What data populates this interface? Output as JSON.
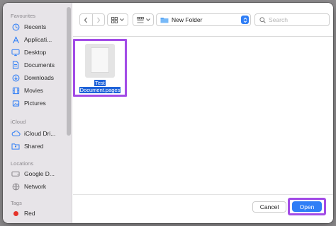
{
  "sidebar": {
    "favourites_header": "Favourites",
    "favourites": [
      {
        "label": "Recents",
        "icon": "clock-icon"
      },
      {
        "label": "Applicati...",
        "icon": "applications-icon"
      },
      {
        "label": "Desktop",
        "icon": "desktop-icon"
      },
      {
        "label": "Documents",
        "icon": "document-icon"
      },
      {
        "label": "Downloads",
        "icon": "download-icon"
      },
      {
        "label": "Movies",
        "icon": "film-icon"
      },
      {
        "label": "Pictures",
        "icon": "pictures-icon"
      }
    ],
    "icloud_header": "iCloud",
    "icloud": [
      {
        "label": "iCloud Dri...",
        "icon": "cloud-icon"
      },
      {
        "label": "Shared",
        "icon": "shared-folder-icon"
      }
    ],
    "locations_header": "Locations",
    "locations": [
      {
        "label": "Google D...",
        "icon": "drive-icon"
      },
      {
        "label": "Network",
        "icon": "network-icon"
      }
    ],
    "tags_header": "Tags",
    "tags": [
      {
        "label": "Red",
        "icon": "red-tag-icon",
        "color": "#e5332a"
      }
    ]
  },
  "toolbar": {
    "folder_name": "New Folder",
    "search_placeholder": "Search"
  },
  "content": {
    "file": {
      "name_line1": "Test",
      "name_line2": "Document.pages",
      "selected": true
    }
  },
  "footer": {
    "cancel_label": "Cancel",
    "open_label": "Open"
  },
  "colors": {
    "accent": "#2f7ef6",
    "highlight_border": "#a24be6",
    "selection": "#1f63d9",
    "sidebar_icon": "#2f7ef6"
  }
}
